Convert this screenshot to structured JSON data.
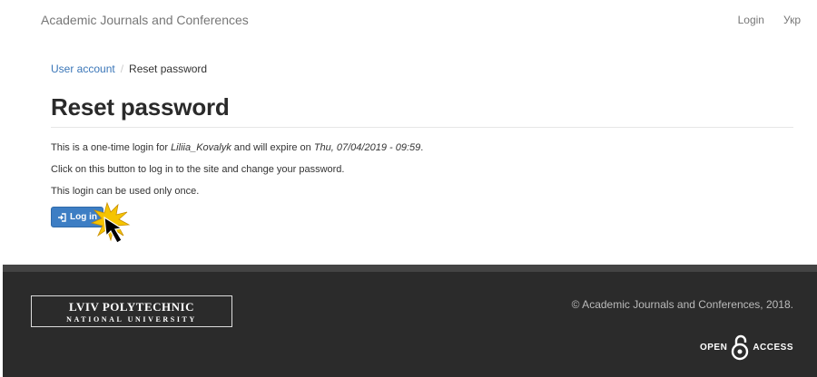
{
  "navbar": {
    "brand": "Academic Journals and Conferences",
    "login": "Login",
    "language": "Укр"
  },
  "breadcrumb": {
    "parent": "User account",
    "separator": "/",
    "current": "Reset password"
  },
  "page": {
    "title": "Reset password",
    "line1_prefix": "This is a one-time login for ",
    "line1_user": "Liliia_Kovalyk",
    "line1_mid": " and will expire on ",
    "line1_date": "Thu, 07/04/2019 - 09:59",
    "line1_suffix": ".",
    "line2": "Click on this button to log in to the site and change your password.",
    "line3": "This login can be used only once.",
    "button_label": "Log in",
    "button_icon": "log-in-icon"
  },
  "footer": {
    "logo_line1": "LVIV POLYTECHNIC",
    "logo_line2": "NATIONAL UNIVERSITY",
    "copyright": "© Academic Journals and Conferences, 2018.",
    "oa_left": "OPEN",
    "oa_right": "ACCESS"
  },
  "colors": {
    "primary": "#3d7ec4",
    "link": "#3a76b8",
    "footer_bg": "#2b2b2b",
    "cursor_burst": "#f5c400"
  }
}
